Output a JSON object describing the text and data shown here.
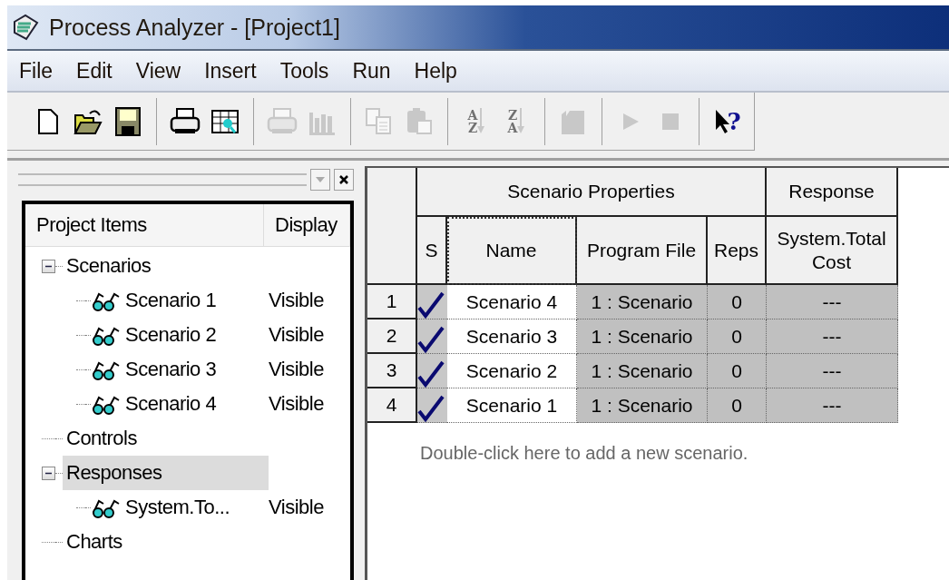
{
  "window": {
    "title": "Process Analyzer - [Project1]"
  },
  "menu": [
    "File",
    "Edit",
    "View",
    "Insert",
    "Tools",
    "Run",
    "Help"
  ],
  "toolbar": [
    {
      "kind": "new",
      "disabled": false
    },
    {
      "kind": "open",
      "disabled": false
    },
    {
      "kind": "save",
      "disabled": false
    },
    {
      "kind": "separator"
    },
    {
      "kind": "print",
      "disabled": false
    },
    {
      "kind": "preview",
      "disabled": false
    },
    {
      "kind": "separator"
    },
    {
      "kind": "print",
      "disabled": true
    },
    {
      "kind": "chart",
      "disabled": true
    },
    {
      "kind": "separator"
    },
    {
      "kind": "copy",
      "disabled": true
    },
    {
      "kind": "paste",
      "disabled": true
    },
    {
      "kind": "separator"
    },
    {
      "kind": "sort",
      "disabled": true,
      "glyphs": [
        "A",
        "Z"
      ]
    },
    {
      "kind": "sort",
      "disabled": true,
      "glyphs": [
        "Z",
        "A"
      ]
    },
    {
      "kind": "separator"
    },
    {
      "kind": "factory",
      "disabled": true
    },
    {
      "kind": "separator"
    },
    {
      "kind": "run",
      "disabled": true
    },
    {
      "kind": "stop",
      "disabled": true
    },
    {
      "kind": "separator"
    },
    {
      "kind": "help",
      "disabled": false,
      "glyphs": [
        "?"
      ]
    }
  ],
  "project_tree": {
    "columns": [
      "Project Items",
      "Display"
    ],
    "items": [
      {
        "label": "Scenarios",
        "kind": "group",
        "expanded": true,
        "selected": false,
        "children": [
          {
            "label": "Scenario 1",
            "kind": "item",
            "display": "Visible",
            "selected": false
          },
          {
            "label": "Scenario 2",
            "kind": "item",
            "display": "Visible",
            "selected": false
          },
          {
            "label": "Scenario 3",
            "kind": "item",
            "display": "Visible",
            "selected": false
          },
          {
            "label": "Scenario 4",
            "kind": "item",
            "display": "Visible",
            "selected": false
          }
        ]
      },
      {
        "label": "Controls",
        "kind": "group",
        "selected": false
      },
      {
        "label": "Responses",
        "kind": "group",
        "expanded": true,
        "selected": true,
        "children": [
          {
            "label": "System.To...",
            "kind": "item",
            "display": "Visible",
            "selected": false
          }
        ]
      },
      {
        "label": "Charts",
        "kind": "group",
        "selected": false
      }
    ]
  },
  "scenario_grid": {
    "group_headers": [
      "Scenario Properties",
      "Response"
    ],
    "columns": [
      "S",
      "Name",
      "Program File",
      "Reps",
      "System.Total Cost"
    ],
    "rows": [
      {
        "number": "1",
        "checked": true,
        "name": "Scenario 4",
        "program_file": "1 : Scenario",
        "reps": "0",
        "cost": "---"
      },
      {
        "number": "2",
        "checked": true,
        "name": "Scenario 3",
        "program_file": "1 : Scenario",
        "reps": "0",
        "cost": "---"
      },
      {
        "number": "3",
        "checked": true,
        "name": "Scenario 2",
        "program_file": "1 : Scenario",
        "reps": "0",
        "cost": "---"
      },
      {
        "number": "4",
        "checked": true,
        "name": "Scenario 1",
        "program_file": "1 : Scenario",
        "reps": "0",
        "cost": "---"
      }
    ],
    "hint": "Double-click here to add a new scenario."
  }
}
